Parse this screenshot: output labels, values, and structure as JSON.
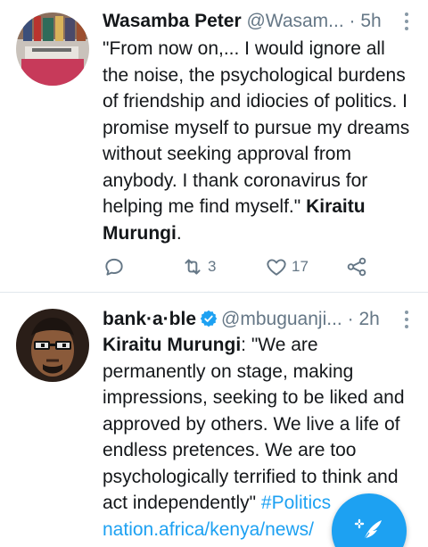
{
  "tweets": [
    {
      "name": "Wasamba Peter",
      "handle": "@Wasam...",
      "separator": "·",
      "time": "5h",
      "text_plain": "\"From now on,... I would ignore all the noise, the psychological burdens of friendship and idiocies of politics. I promise myself to pursue my dreams without seeking approval from anybody. I thank coronavirus for helping me find myself.\" ",
      "text_bold": "Kiraitu Murungi",
      "text_end": ".",
      "retweets": "3",
      "likes": "17",
      "reply_icon": "reply-icon",
      "retweet_icon": "retweet-icon",
      "like_icon": "heart-icon",
      "share_icon": "share-icon"
    },
    {
      "name": "bank·a·ble",
      "handle": "@mbuguanji...",
      "separator": "·",
      "time": "2h",
      "text_bold": "Kiraitu Murungi",
      "text_plain": ": \"We are permanently on stage, making impressions, seeking to be liked and approved by others. We live a life of endless pretences. We are too psychologically terrified to think and act independently\" ",
      "hashtag": "#Politics",
      "link": "nation.africa/kenya/news/"
    }
  ],
  "colors": {
    "accent": "#1da1f2",
    "text": "#14171a",
    "secondary": "#657786",
    "divider": "#e1e8ed"
  },
  "fab_icon": "compose-tweet-icon"
}
